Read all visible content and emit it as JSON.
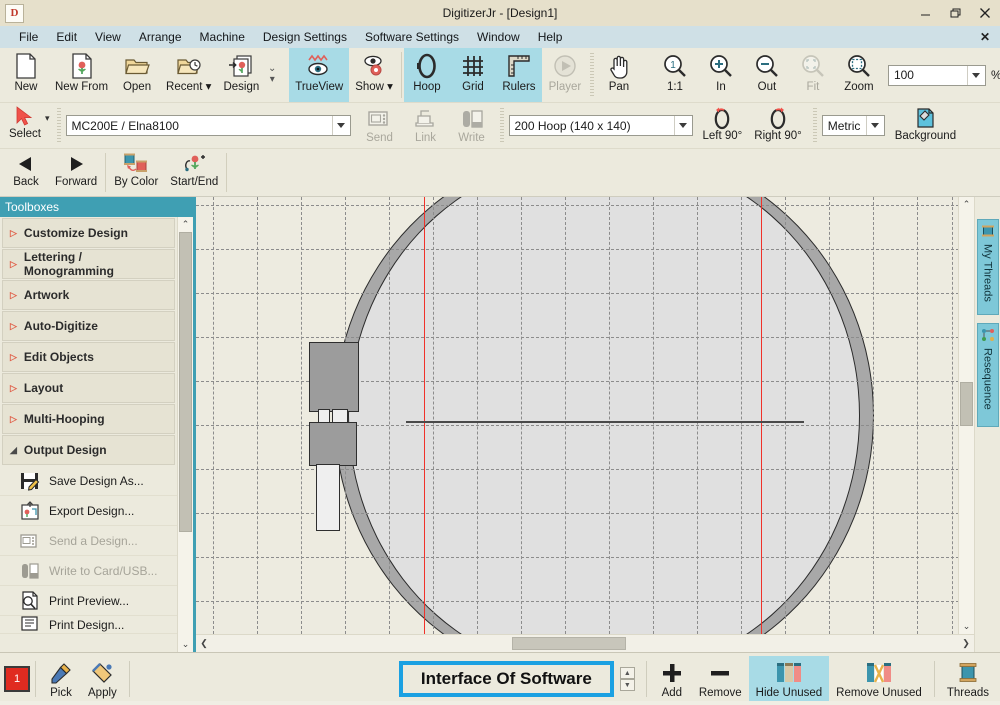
{
  "window": {
    "logo_letter": "D",
    "title": "DigitizerJr - [Design1]",
    "minimize": "minimize-icon",
    "restore": "restore-icon",
    "close": "close-icon"
  },
  "menubar": {
    "items": [
      {
        "label": "File"
      },
      {
        "label": "Edit"
      },
      {
        "label": "View"
      },
      {
        "label": "Arrange"
      },
      {
        "label": "Machine"
      },
      {
        "label": "Design Settings"
      },
      {
        "label": "Software Settings"
      },
      {
        "label": "Window"
      },
      {
        "label": "Help"
      }
    ],
    "close_doc": "✕"
  },
  "ribbon": {
    "row1_file": [
      {
        "label": "New",
        "icon": "new-document-icon",
        "state": "normal"
      },
      {
        "label": "New From",
        "icon": "new-from-design-icon",
        "state": "normal"
      },
      {
        "label": "Open",
        "icon": "open-folder-icon",
        "state": "normal"
      },
      {
        "label": "Recent",
        "icon": "recent-folder-clock-icon",
        "state": "normal",
        "dropdown": true
      },
      {
        "label": "Design",
        "icon": "insert-design-icon",
        "state": "normal"
      }
    ],
    "row1_view": [
      {
        "label": "TrueView",
        "icon": "trueview-eye-icon",
        "state": "active"
      },
      {
        "label": "Show",
        "icon": "show-eye-gear-icon",
        "state": "normal",
        "dropdown": true
      },
      {
        "label": "Hoop",
        "icon": "hoop-icon",
        "state": "active"
      },
      {
        "label": "Grid",
        "icon": "grid-icon",
        "state": "active"
      },
      {
        "label": "Rulers",
        "icon": "ruler-icon",
        "state": "active"
      },
      {
        "label": "Player",
        "icon": "player-play-icon",
        "state": "disabled"
      },
      {
        "label": "Pan",
        "icon": "pan-hand-icon",
        "state": "normal"
      }
    ],
    "row1_zoom": [
      {
        "label": "1:1",
        "icon": "zoom-actual-size-icon",
        "state": "normal"
      },
      {
        "label": "In",
        "icon": "zoom-in-icon",
        "state": "normal"
      },
      {
        "label": "Out",
        "icon": "zoom-out-icon",
        "state": "normal"
      },
      {
        "label": "Fit",
        "icon": "zoom-fit-icon",
        "state": "disabled"
      },
      {
        "label": "Zoom",
        "icon": "zoom-box-icon",
        "state": "normal"
      }
    ],
    "zoom_value": "100",
    "zoom_unit": "%",
    "row2": {
      "select_label": "Select",
      "select_icon": "arrow-pointer-icon",
      "machine_value": "MC200E / Elna8100",
      "send_label": "Send",
      "send_icon": "send-machine-icon",
      "link_label": "Link",
      "link_icon": "link-machine-icon",
      "write_label": "Write",
      "write_icon": "write-card-usb-icon",
      "hoop_value": "200 Hoop (140 x 140)",
      "left90_label": "Left 90°",
      "left90_icon": "rotate-left-icon",
      "right90_label": "Right 90°",
      "right90_icon": "rotate-right-icon",
      "units_value": "Metric",
      "background_label": "Background",
      "background_icon": "background-fill-icon"
    },
    "row3": [
      {
        "label": "Back",
        "icon": "back-triangle-icon"
      },
      {
        "label": "Forward",
        "icon": "forward-triangle-icon"
      },
      {
        "label": "By Color",
        "icon": "by-color-spools-icon"
      },
      {
        "label": "Start/End",
        "icon": "start-end-flower-icon"
      }
    ]
  },
  "toolbox": {
    "header": "Toolboxes",
    "groups": [
      {
        "label": "Customize Design",
        "expanded": false
      },
      {
        "label": "Lettering / Monogramming",
        "expanded": false
      },
      {
        "label": "Artwork",
        "expanded": false
      },
      {
        "label": "Auto-Digitize",
        "expanded": false
      },
      {
        "label": "Edit Objects",
        "expanded": false
      },
      {
        "label": "Layout",
        "expanded": false
      },
      {
        "label": "Multi-Hooping",
        "expanded": false
      },
      {
        "label": "Output Design",
        "expanded": true
      }
    ],
    "commands": [
      {
        "label": "Save Design As...",
        "icon": "save-design-as-icon",
        "state": "normal"
      },
      {
        "label": "Export Design...",
        "icon": "export-design-icon",
        "state": "normal"
      },
      {
        "label": "Send a Design...",
        "icon": "send-design-icon",
        "state": "disabled"
      },
      {
        "label": "Write to Card/USB...",
        "icon": "write-card-usb-icon",
        "state": "disabled"
      },
      {
        "label": "Print Preview...",
        "icon": "print-preview-icon",
        "state": "normal"
      },
      {
        "label": "Print Design...",
        "icon": "print-design-icon",
        "state": "normal"
      }
    ]
  },
  "rightdock": {
    "tabs": [
      {
        "label": "My Threads",
        "icon": "thread-spool-icon"
      },
      {
        "label": "Resequence",
        "icon": "resequence-icon"
      }
    ]
  },
  "canvas": {
    "hoop_name": "200 Hoop (140 x 140)",
    "guide_color": "#f0322a",
    "grid_color": "#8c8c8c",
    "hoop_ring_color": "#a8a8a8",
    "hoop_inner_color": "#e0e0e0"
  },
  "bottombar": {
    "color_index": "1",
    "pick_label": "Pick",
    "pick_icon": "eyedropper-icon",
    "apply_label": "Apply",
    "apply_icon": "paint-apply-icon",
    "callout_text": "Interface Of Software",
    "callout_color": "#1ba1e2",
    "add_label": "Add",
    "add_icon": "plus-icon",
    "remove_label": "Remove",
    "remove_icon": "minus-icon",
    "hide_unused_label": "Hide Unused",
    "hide_unused_icon": "hide-unused-threads-icon",
    "remove_unused_label": "Remove Unused",
    "remove_unused_icon": "remove-unused-threads-icon",
    "threads_label": "Threads",
    "threads_icon": "thread-spool-icon"
  }
}
